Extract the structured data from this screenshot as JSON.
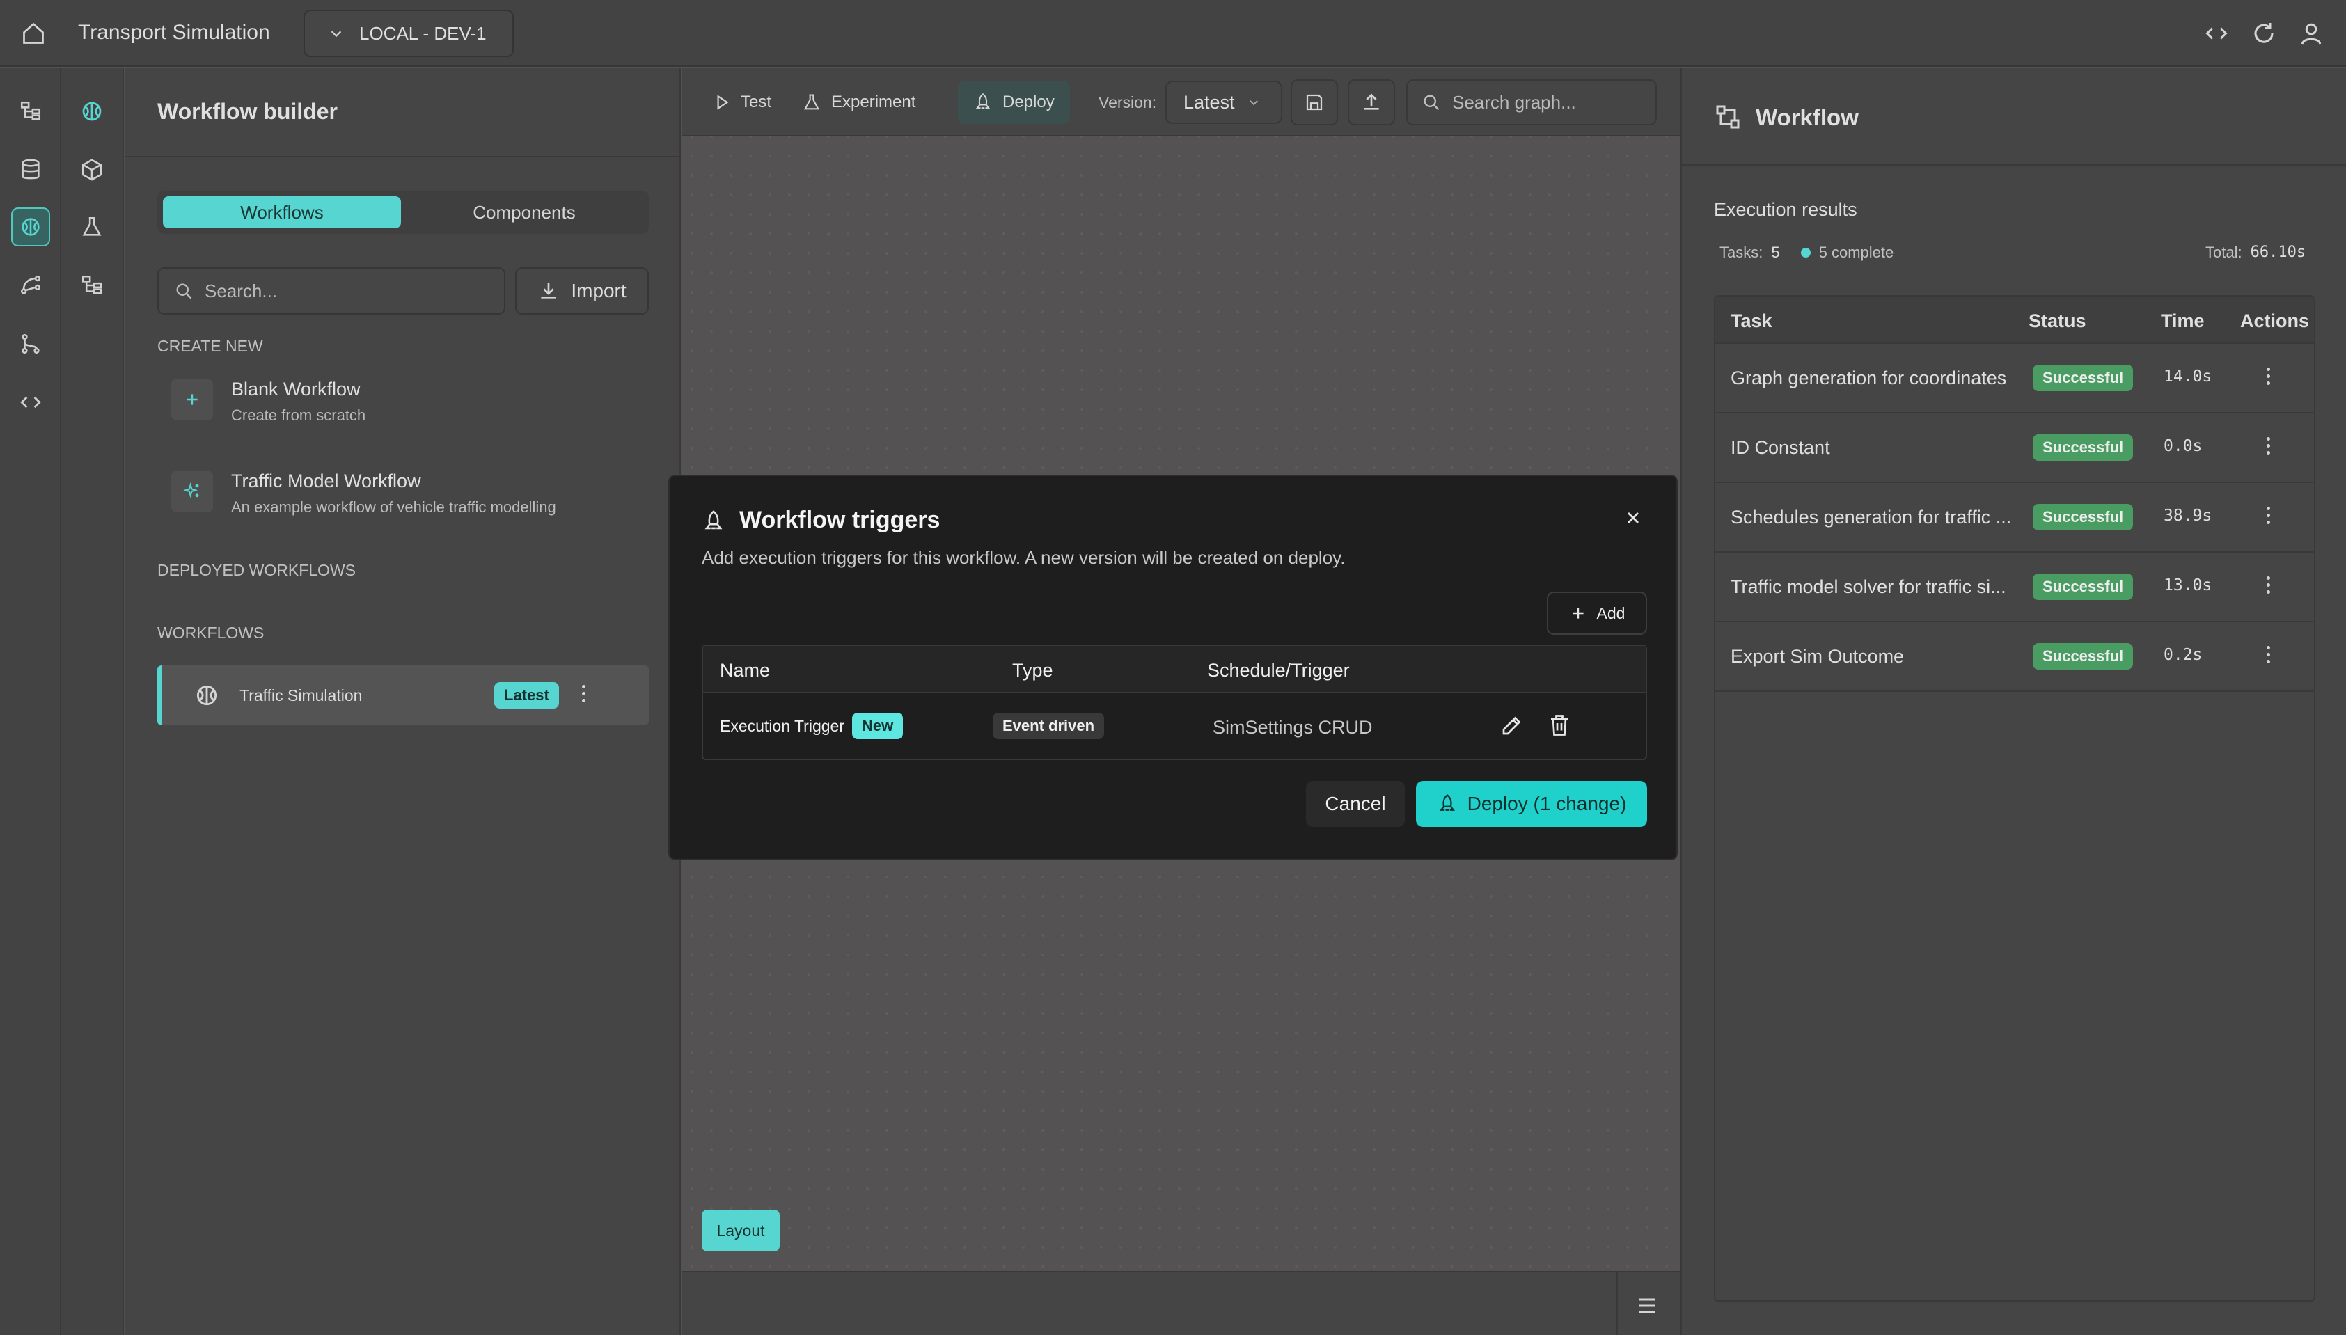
{
  "topbar": {
    "app_title": "Transport Simulation",
    "environment": "LOCAL - DEV-1"
  },
  "sidebar": {
    "title": "Workflow builder",
    "tabs": [
      "Workflows",
      "Components"
    ],
    "search_placeholder": "Search...",
    "import_label": "Import",
    "create_new_heading": "CREATE NEW",
    "create_items": [
      {
        "title": "Blank Workflow",
        "subtitle": "Create from scratch"
      },
      {
        "title": "Traffic Model Workflow",
        "subtitle": "An example workflow of vehicle traffic modelling"
      }
    ],
    "deployed_heading": "DEPLOYED WORKFLOWS",
    "workflows_heading": "WORKFLOWS",
    "workflow_item": {
      "name": "Traffic Simulation",
      "badge": "Latest"
    }
  },
  "toolbar": {
    "test_label": "Test",
    "experiment_label": "Experiment",
    "deploy_label": "Deploy",
    "version_label": "Version:",
    "version_value": "Latest",
    "search_placeholder": "Search graph..."
  },
  "canvas": {
    "layout_button": "Layout"
  },
  "right_panel": {
    "title": "Workflow",
    "section_title": "Execution results",
    "tasks_label": "Tasks:",
    "tasks_count": "5",
    "complete_label": "5 complete",
    "total_label": "Total:",
    "total_value": "66.10s",
    "headers": [
      "Task",
      "Status",
      "Time",
      "Actions"
    ],
    "rows": [
      {
        "task": "Graph generation for coordinates",
        "status": "Successful",
        "time": "14.0s"
      },
      {
        "task": "ID Constant",
        "status": "Successful",
        "time": "0.0s"
      },
      {
        "task": "Schedules generation for traffic ...",
        "status": "Successful",
        "time": "38.9s"
      },
      {
        "task": "Traffic model solver for traffic si...",
        "status": "Successful",
        "time": "13.0s"
      },
      {
        "task": "Export Sim Outcome",
        "status": "Successful",
        "time": "0.2s"
      }
    ]
  },
  "modal": {
    "title": "Workflow triggers",
    "description": "Add execution triggers for this workflow. A new version will be created on deploy.",
    "add_label": "Add",
    "headers": [
      "Name",
      "Type",
      "Schedule/Trigger"
    ],
    "trigger": {
      "name": "Execution Trigger",
      "new_badge": "New",
      "type": "Event driven",
      "schedule": "SimSettings CRUD"
    },
    "cancel_label": "Cancel",
    "deploy_label": "Deploy (1 change)"
  },
  "colors": {
    "accent": "#5ee6e0",
    "background": "#5a5858",
    "panel": "#4c4b4b",
    "modal": "#1f1e1e",
    "success": "#4fa86a"
  }
}
